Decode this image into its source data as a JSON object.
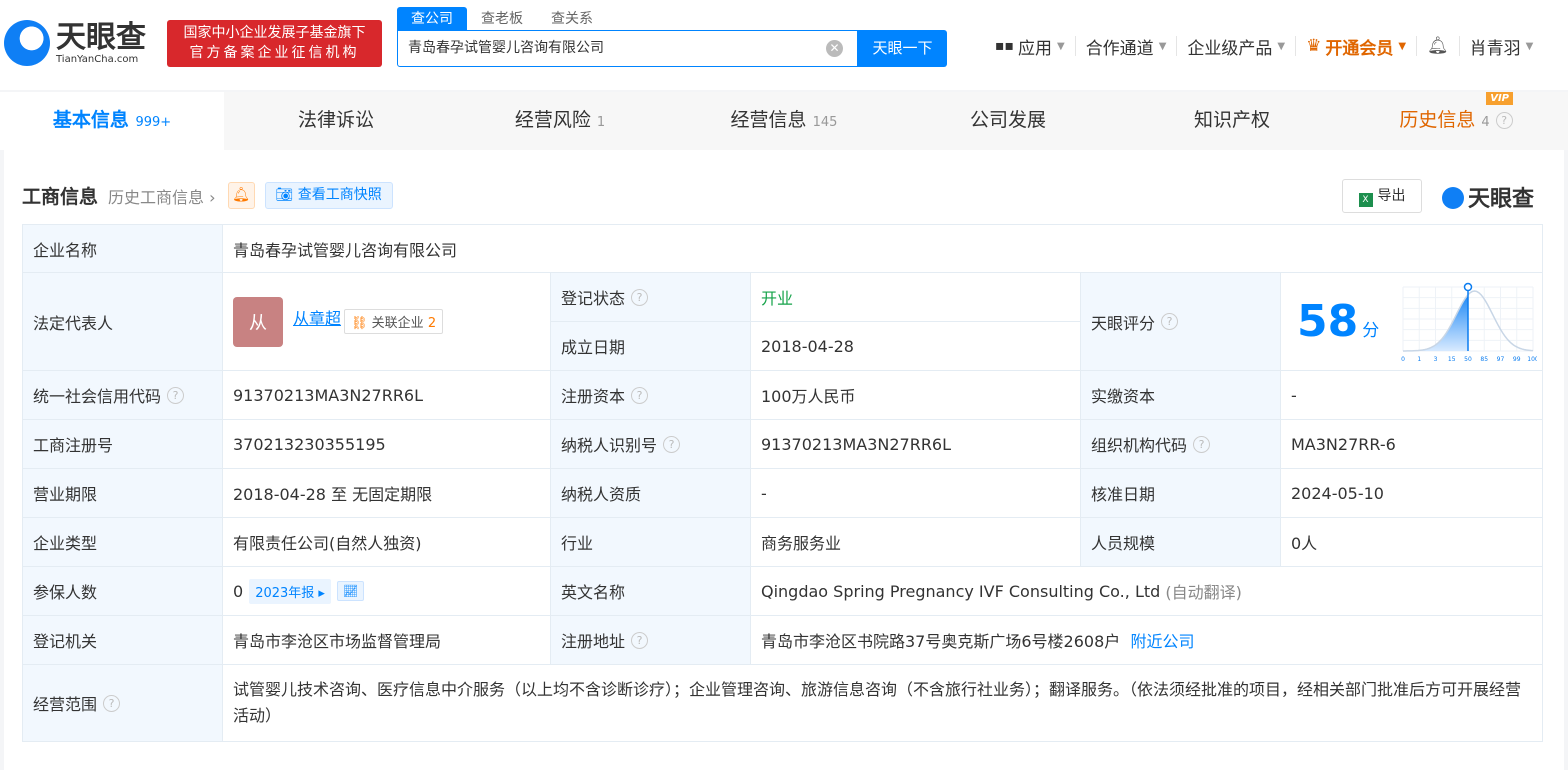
{
  "header": {
    "logo_cn": "天眼查",
    "logo_en": "TianYanCha.com",
    "badge_line1": "国家中小企业发展子基金旗下",
    "badge_line2": "官方备案企业征信机构",
    "search_tabs": [
      "查公司",
      "查老板",
      "查关系"
    ],
    "search_value": "青岛春孕试管婴儿咨询有限公司",
    "search_button": "天眼一下",
    "nav": [
      "应用",
      "合作通道",
      "企业级产品",
      "开通会员",
      "肖青羽"
    ]
  },
  "tabs": [
    {
      "label": "基本信息",
      "count": "999+"
    },
    {
      "label": "法律诉讼",
      "count": ""
    },
    {
      "label": "经营风险",
      "count": "1"
    },
    {
      "label": "经营信息",
      "count": "145"
    },
    {
      "label": "公司发展",
      "count": ""
    },
    {
      "label": "知识产权",
      "count": ""
    },
    {
      "label": "历史信息",
      "count": "4",
      "tag": "VIP"
    }
  ],
  "section": {
    "title": "工商信息",
    "history": "历史工商信息",
    "snapshot": "查看工商快照",
    "export": "导出",
    "brand": "天眼查"
  },
  "info": {
    "name_label": "企业名称",
    "name": "青岛春孕试管婴儿咨询有限公司",
    "rep_label": "法定代表人",
    "rep_avatar": "从",
    "rep": "从章超",
    "rel_label": "关联企业",
    "rel_count": "2",
    "status_label": "登记状态",
    "status": "开业",
    "date_label": "成立日期",
    "date": "2018-04-28",
    "score_label": "天眼评分",
    "score": "58",
    "score_unit": "分",
    "credit_label": "统一社会信用代码",
    "credit": "91370213MA3N27RR6L",
    "capital_label": "注册资本",
    "capital": "100万人民币",
    "paid_label": "实缴资本",
    "paid": "-",
    "reg_label": "工商注册号",
    "reg": "370213230355195",
    "tax_label": "纳税人识别号",
    "tax": "91370213MA3N27RR6L",
    "org_label": "组织机构代码",
    "org": "MA3N27RR-6",
    "term_label": "营业期限",
    "term": "2018-04-28 至 无固定期限",
    "taxq_label": "纳税人资质",
    "taxq": "-",
    "approve_label": "核准日期",
    "approve": "2024-05-10",
    "type_label": "企业类型",
    "type": "有限责任公司(自然人独资)",
    "industry_label": "行业",
    "industry": "商务服务业",
    "staff_label": "人员规模",
    "staff": "0人",
    "insured_label": "参保人数",
    "insured": "0",
    "report": "2023年报",
    "en_label": "英文名称",
    "en": "Qingdao Spring Pregnancy IVF Consulting Co., Ltd",
    "en_note": "(自动翻译)",
    "authority_label": "登记机关",
    "authority": "青岛市李沧区市场监督管理局",
    "addr_label": "注册地址",
    "addr": "青岛市李沧区书院路37号奥克斯广场6号楼2608户",
    "nearby": "附近公司",
    "scope_label": "经营范围",
    "scope": "试管婴儿技术咨询、医疗信息中介服务（以上均不含诊断诊疗）；企业管理咨询、旅游信息咨询（不含旅行社业务）；翻译服务。（依法须经批准的项目，经相关部门批准后方可开展经营活动）"
  },
  "score_chart": {
    "ticks": [
      "0",
      "1",
      "3",
      "15",
      "50",
      "85",
      "97",
      "99",
      "100"
    ],
    "marker": "50"
  }
}
